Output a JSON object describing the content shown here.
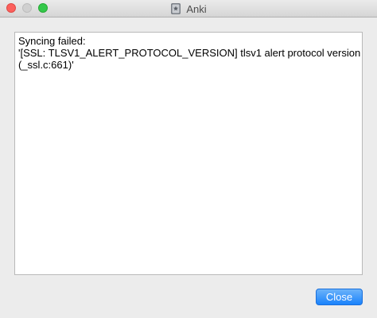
{
  "window": {
    "title": "Anki",
    "app_icon": "anki-icon"
  },
  "message": {
    "lines": [
      "Syncing failed:",
      "'[SSL: TLSV1_ALERT_PROTOCOL_VERSION] tlsv1 alert protocol version",
      "(_ssl.c:661)'"
    ]
  },
  "buttons": {
    "close_label": "Close"
  },
  "colors": {
    "accent": "#1a82fb",
    "close_traffic": "#fc605c",
    "max_traffic": "#34c84a"
  }
}
